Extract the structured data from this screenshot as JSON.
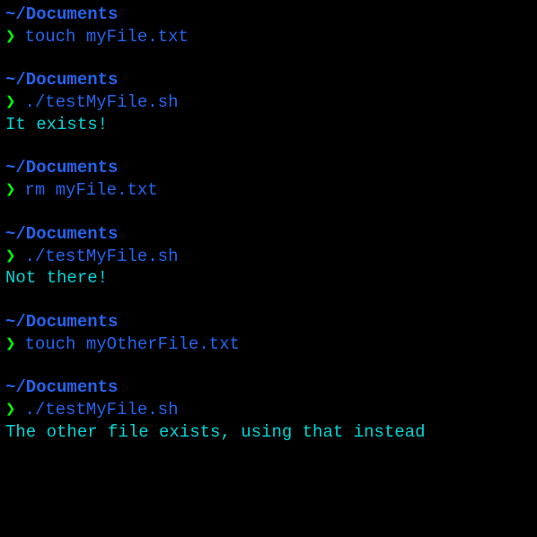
{
  "blocks": [
    {
      "path": "~/Documents",
      "prompt": "❯",
      "command": "touch myFile.txt",
      "output": null
    },
    {
      "path": "~/Documents",
      "prompt": "❯",
      "command": "./testMyFile.sh",
      "output": "It exists!"
    },
    {
      "path": "~/Documents",
      "prompt": "❯",
      "command": "rm myFile.txt",
      "output": null
    },
    {
      "path": "~/Documents",
      "prompt": "❯",
      "command": "./testMyFile.sh",
      "output": "Not there!"
    },
    {
      "path": "~/Documents",
      "prompt": "❯",
      "command": "touch myOtherFile.txt",
      "output": null
    },
    {
      "path": "~/Documents",
      "prompt": "❯",
      "command": "./testMyFile.sh",
      "output": "The other file exists, using that instead"
    }
  ]
}
